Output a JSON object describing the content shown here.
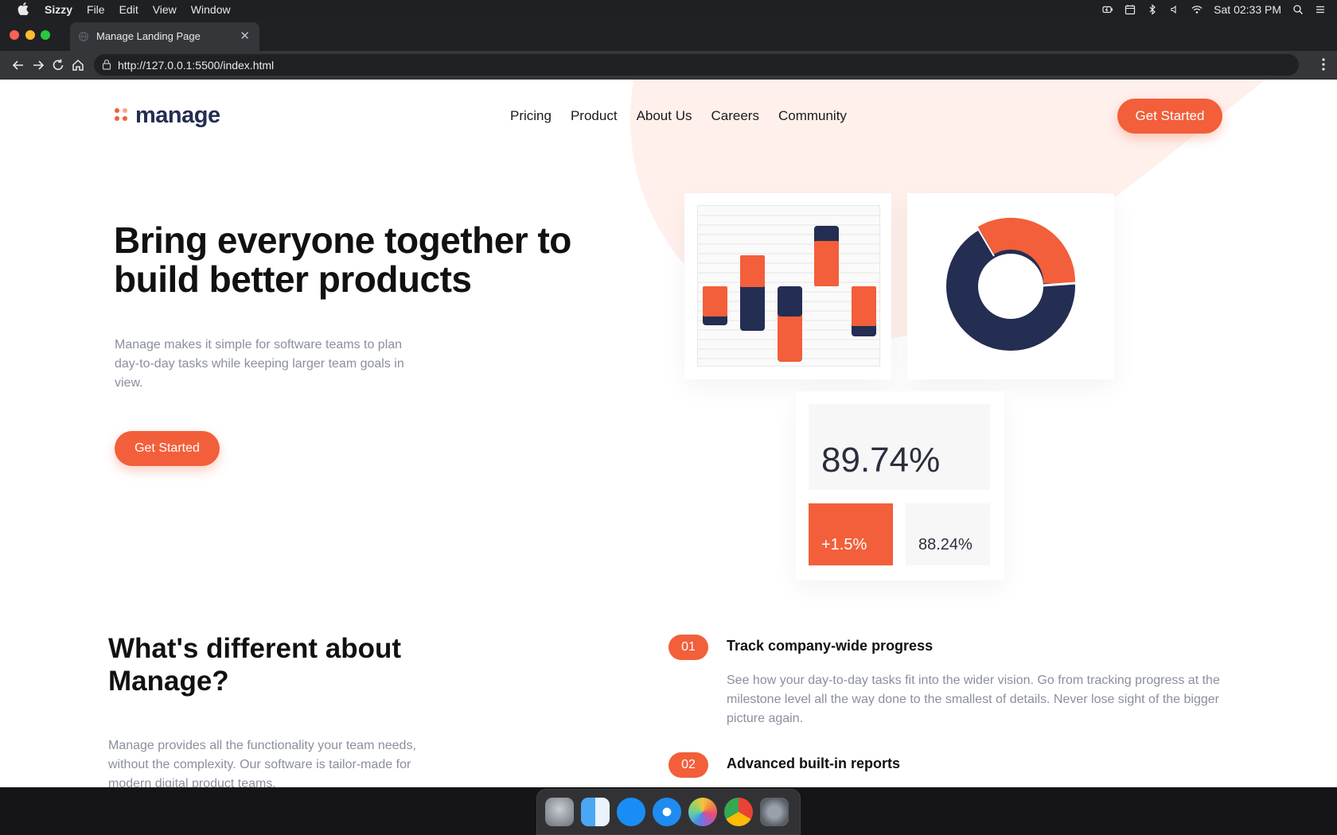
{
  "menubar": {
    "app_name": "Sizzy",
    "menus": [
      "File",
      "Edit",
      "View",
      "Window"
    ],
    "clock": "Sat 02:33 PM",
    "status_icons": [
      "battery-icon",
      "calendar-icon",
      "bluetooth-icon",
      "volume-icon",
      "wifi-icon",
      "spotlight-icon",
      "control-center-icon"
    ]
  },
  "browser": {
    "tab_title": "Manage Landing Page",
    "url": "http://127.0.0.1:5500/index.html"
  },
  "page": {
    "logo": "manage",
    "nav": [
      "Pricing",
      "Product",
      "About Us",
      "Careers",
      "Community"
    ],
    "cta_label": "Get Started",
    "hero": {
      "title": "Bring everyone together to build better products",
      "description": "Manage makes it simple for software teams to plan day-to-day tasks while keeping larger team goals in view.",
      "cta_label": "Get Started"
    },
    "stats": {
      "main": "89.74%",
      "delta": "+1.5%",
      "secondary": "88.24%"
    },
    "different": {
      "title": "What's different about Manage?",
      "description": "Manage provides all the functionality your team needs, without the complexity. Our software is tailor-made for modern digital product teams."
    },
    "features": [
      {
        "num": "01",
        "title": "Track company-wide progress",
        "description": "See how your day-to-day tasks fit into the wider vision. Go from tracking progress at the milestone level all the way done to the smallest of details. Never lose sight of the bigger picture again."
      },
      {
        "num": "02",
        "title": "Advanced built-in reports",
        "description": ""
      }
    ]
  },
  "colors": {
    "accent": "#f25f3a",
    "navy": "#242d52",
    "bg_shape": "#fff0ec"
  },
  "dock": [
    "launchpad-icon",
    "finder-icon",
    "app-store-icon",
    "safari-icon",
    "photos-icon",
    "chrome-icon",
    "system-preferences-icon"
  ]
}
